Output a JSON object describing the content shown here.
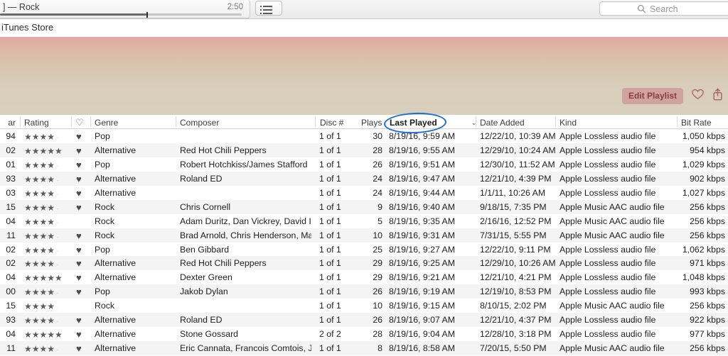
{
  "player": {
    "track_title": "] — Rock",
    "duration": "2:50",
    "progress_percent": 60.5,
    "list_view_icon": "list-view-icon"
  },
  "search": {
    "placeholder": "Search",
    "icon": "search-icon"
  },
  "store": {
    "label": "iTunes Store"
  },
  "banner": {
    "edit_playlist_label": "Edit Playlist",
    "love_icon": "heart-outline-icon",
    "share_icon": "share-icon",
    "gradient_top": "#e5a79f",
    "gradient_bottom": "#d8d0bd"
  },
  "annotation": {
    "shape": "ellipse",
    "color": "#1b6fd4",
    "targets": "Last Played"
  },
  "table": {
    "sort_column": "Last Played",
    "sort_chevron": "⌄",
    "columns": [
      {
        "key": "year",
        "label": "ar"
      },
      {
        "key": "rating",
        "label": "Rating"
      },
      {
        "key": "love",
        "label": "♡"
      },
      {
        "key": "genre",
        "label": "Genre"
      },
      {
        "key": "composer",
        "label": "Composer"
      },
      {
        "key": "disc",
        "label": "Disc #"
      },
      {
        "key": "plays",
        "label": "Plays"
      },
      {
        "key": "last",
        "label": "Last Played"
      },
      {
        "key": "added",
        "label": "Date Added"
      },
      {
        "key": "kind",
        "label": "Kind"
      },
      {
        "key": "bitrate",
        "label": "Bit Rate"
      }
    ],
    "rows": [
      {
        "year": "94",
        "rating": 4,
        "loved": true,
        "genre": "Pop",
        "composer": "",
        "disc": "1 of 1",
        "plays": "30",
        "last": "8/19/16, 9:59 AM",
        "added": "12/22/10, 10:39 AM",
        "kind": "Apple Lossless audio file",
        "bitrate": "1,050 kbps"
      },
      {
        "year": "02",
        "rating": 5,
        "loved": true,
        "genre": "Alternative",
        "composer": "Red Hot Chili Peppers",
        "disc": "1 of 1",
        "plays": "28",
        "last": "8/19/16, 9:55 AM",
        "added": "12/29/10, 10:24 AM",
        "kind": "Apple Lossless audio file",
        "bitrate": "954 kbps"
      },
      {
        "year": "01",
        "rating": 4,
        "loved": true,
        "genre": "Pop",
        "composer": "Robert Hotchkiss/James Stafford",
        "disc": "1 of 1",
        "plays": "26",
        "last": "8/19/16, 9:51 AM",
        "added": "12/30/10, 11:52 AM",
        "kind": "Apple Lossless audio file",
        "bitrate": "1,029 kbps"
      },
      {
        "year": "93",
        "rating": 4,
        "loved": true,
        "genre": "Alternative",
        "composer": "Roland ED",
        "disc": "1 of 1",
        "plays": "24",
        "last": "8/19/16, 9:47 AM",
        "added": "12/21/10, 4:39 PM",
        "kind": "Apple Lossless audio file",
        "bitrate": "902 kbps"
      },
      {
        "year": "03",
        "rating": 4,
        "loved": true,
        "genre": "Alternative",
        "composer": "",
        "disc": "1 of 1",
        "plays": "24",
        "last": "8/19/16, 9:44 AM",
        "added": "1/1/11, 10:26 AM",
        "kind": "Apple Lossless audio file",
        "bitrate": "1,027 kbps"
      },
      {
        "year": "15",
        "rating": 4,
        "loved": true,
        "genre": "Rock",
        "composer": "Chris Cornell",
        "disc": "1 of 1",
        "plays": "9",
        "last": "8/19/16, 9:40 AM",
        "added": "9/18/15, 7:35 PM",
        "kind": "Apple Music AAC audio file",
        "bitrate": "256 kbps"
      },
      {
        "year": "04",
        "rating": 4,
        "loved": false,
        "genre": "Rock",
        "composer": "Adam Duritz, Dan Vickrey, David I…",
        "disc": "1 of 1",
        "plays": "5",
        "last": "8/19/16, 9:35 AM",
        "added": "2/16/16, 12:52 PM",
        "kind": "Apple Music AAC audio file",
        "bitrate": "256 kbps"
      },
      {
        "year": "11",
        "rating": 4,
        "loved": true,
        "genre": "Rock",
        "composer": "Brad Arnold, Chris Henderson, Ma…",
        "disc": "1 of 1",
        "plays": "10",
        "last": "8/19/16, 9:31 AM",
        "added": "7/31/15, 5:55 PM",
        "kind": "Apple Music AAC audio file",
        "bitrate": "256 kbps"
      },
      {
        "year": "02",
        "rating": 4,
        "loved": true,
        "genre": "Pop",
        "composer": "Ben Gibbard",
        "disc": "1 of 1",
        "plays": "25",
        "last": "8/19/16, 9:27 AM",
        "added": "12/22/10, 9:11 PM",
        "kind": "Apple Lossless audio file",
        "bitrate": "1,062 kbps"
      },
      {
        "year": "02",
        "rating": 4,
        "loved": true,
        "genre": "Alternative",
        "composer": "Red Hot Chili Peppers",
        "disc": "1 of 1",
        "plays": "29",
        "last": "8/19/16, 9:25 AM",
        "added": "12/29/10, 10:26 AM",
        "kind": "Apple Lossless audio file",
        "bitrate": "971 kbps"
      },
      {
        "year": "04",
        "rating": 5,
        "loved": true,
        "genre": "Alternative",
        "composer": "Dexter Green",
        "disc": "1 of 1",
        "plays": "29",
        "last": "8/19/16, 9:21 AM",
        "added": "12/21/10, 4:21 PM",
        "kind": "Apple Lossless audio file",
        "bitrate": "1,048 kbps"
      },
      {
        "year": "00",
        "rating": 4,
        "loved": true,
        "genre": "Pop",
        "composer": "Jakob Dylan",
        "disc": "1 of 1",
        "plays": "26",
        "last": "8/19/16, 9:19 AM",
        "added": "12/19/10, 8:53 PM",
        "kind": "Apple Lossless audio file",
        "bitrate": "993 kbps"
      },
      {
        "year": "15",
        "rating": 4,
        "loved": false,
        "genre": "Rock",
        "composer": "",
        "disc": "1 of 1",
        "plays": "10",
        "last": "8/19/16, 9:15 AM",
        "added": "8/10/15, 2:02 PM",
        "kind": "Apple Music AAC audio file",
        "bitrate": "256 kbps"
      },
      {
        "year": "93",
        "rating": 4,
        "loved": true,
        "genre": "Alternative",
        "composer": "Roland ED",
        "disc": "1 of 1",
        "plays": "26",
        "last": "8/19/16, 9:07 AM",
        "added": "12/21/10, 4:37 PM",
        "kind": "Apple Lossless audio file",
        "bitrate": "922 kbps"
      },
      {
        "year": "04",
        "rating": 5,
        "loved": true,
        "genre": "Alternative",
        "composer": "Stone Gossard",
        "disc": "2 of 2",
        "plays": "28",
        "last": "8/19/16, 9:04 AM",
        "added": "12/28/10, 3:18 PM",
        "kind": "Apple Lossless audio file",
        "bitrate": "977 kbps"
      },
      {
        "year": "11",
        "rating": 4,
        "loved": true,
        "genre": "Alternative",
        "composer": "Eric Cannata, Francois Comtois, Ja…",
        "disc": "1 of 1",
        "plays": "8",
        "last": "8/19/16, 8:58 AM",
        "added": "7/20/15, 5:50 PM",
        "kind": "Apple Music AAC audio file",
        "bitrate": "256 kbps"
      }
    ]
  }
}
